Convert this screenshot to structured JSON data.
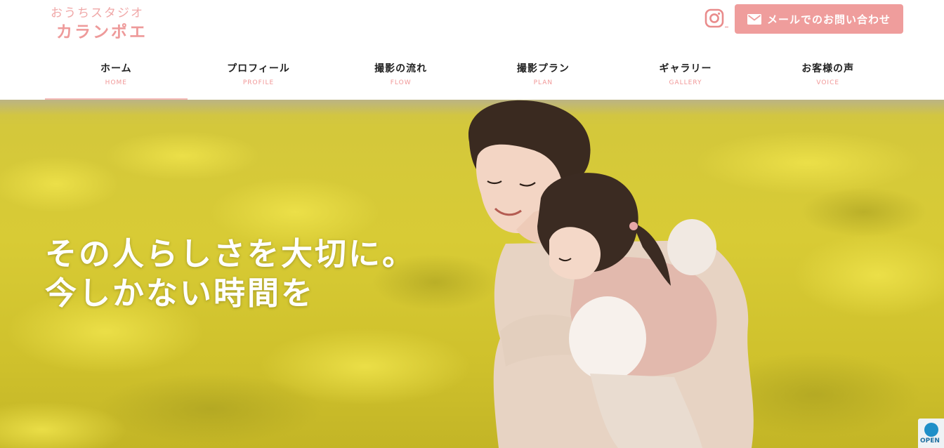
{
  "site": {
    "logo_sub": "おうちスタジオ",
    "logo_main": "カランポエ"
  },
  "header": {
    "instagram_icon": "instagram-icon",
    "mail_icon": "mail-icon",
    "contact_label": "メールでのお問い合わせ"
  },
  "nav": {
    "items": [
      {
        "jp": "ホーム",
        "en": "HOME",
        "active": true
      },
      {
        "jp": "プロフィール",
        "en": "PROFILE",
        "active": false
      },
      {
        "jp": "撮影の流れ",
        "en": "FLOW",
        "active": false
      },
      {
        "jp": "撮影プラン",
        "en": "PLAN",
        "active": false
      },
      {
        "jp": "ギャラリー",
        "en": "GALLERY",
        "active": false
      },
      {
        "jp": "お客様の声",
        "en": "VOICE",
        "active": false
      }
    ]
  },
  "hero": {
    "line1": "その人らしさを大切に。",
    "line2": "今しかない時間を",
    "image": "mother-carrying-child-in-rapeseed-field"
  },
  "badge": {
    "label": "OPEN"
  },
  "colors": {
    "accent": "#ef9d9c",
    "nav_en": "#f19797",
    "field_yellow": "#d8cb35"
  }
}
